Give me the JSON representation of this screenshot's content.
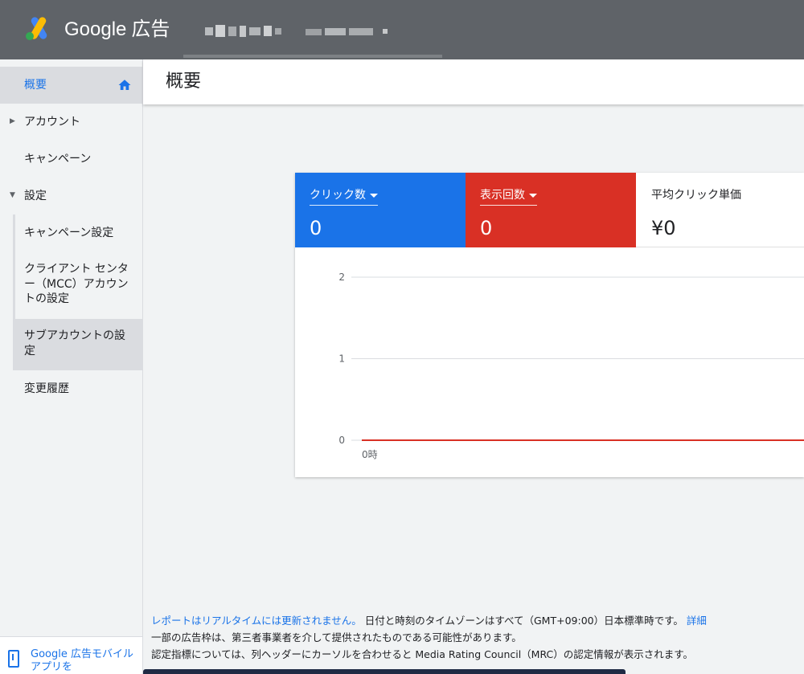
{
  "header": {
    "brand": "Google",
    "product": "広告"
  },
  "sidebar": {
    "items": [
      {
        "label": "概要"
      },
      {
        "label": "アカウント"
      },
      {
        "label": "キャンペーン"
      },
      {
        "label": "設定"
      }
    ],
    "settings_sub": [
      {
        "label": "キャンペーン設定"
      },
      {
        "label": "クライアント センター（MCC）アカウントの設定"
      },
      {
        "label": "サブアカウントの設定"
      }
    ],
    "history": "変更履歴",
    "mobile_promo": "Google 広告モバイルアプリを"
  },
  "page": {
    "title": "概要"
  },
  "metrics": {
    "clicks": {
      "label": "クリック数",
      "value": "0"
    },
    "impressions": {
      "label": "表示回数",
      "value": "0"
    },
    "avg_cpc": {
      "label": "平均クリック単価",
      "value": "¥0"
    }
  },
  "colors": {
    "clicks": "#1a73e8",
    "impressions": "#d93025",
    "header": "#5f6368"
  },
  "chart_data": {
    "type": "line",
    "x": [
      "0時"
    ],
    "series": [
      {
        "values": [
          0,
          0
        ]
      }
    ],
    "yticks": [
      "0",
      "1",
      "2"
    ],
    "ylim": [
      0,
      2
    ],
    "grid": true
  },
  "footer": {
    "realtime_link": "レポートはリアルタイムには更新されません。",
    "timezone_text": "日付と時刻のタイムゾーンはすべて（GMT+09:00）日本標準時です。",
    "details_link": "詳細",
    "line2": "一部の広告枠は、第三者事業者を介して提供されたものである可能性があります。",
    "line3": "認定指標については、列ヘッダーにカーソルを合わせると Media Rating Council（MRC）の認定情報が表示されます。"
  }
}
